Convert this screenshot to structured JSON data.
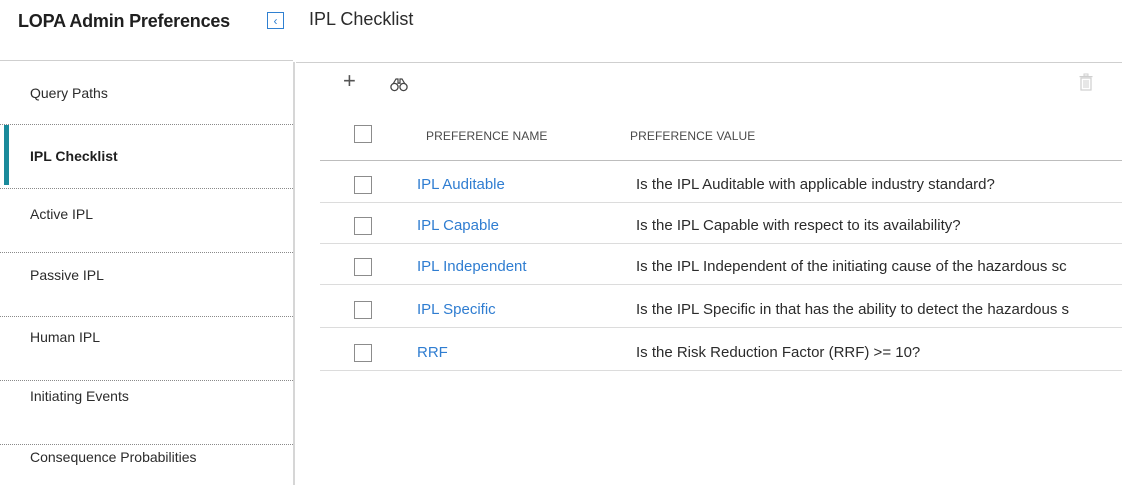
{
  "header": {
    "app_title": "LOPA Admin Preferences",
    "collapse_icon": "chevron-left-icon",
    "page_title": "IPL Checklist"
  },
  "sidebar": {
    "items": [
      {
        "label": "Query Paths",
        "active": false
      },
      {
        "label": "IPL Checklist",
        "active": true
      },
      {
        "label": "Active IPL",
        "active": false
      },
      {
        "label": "Passive IPL",
        "active": false
      },
      {
        "label": "Human IPL",
        "active": false
      },
      {
        "label": "Initiating Events",
        "active": false
      },
      {
        "label": "Consequence Probabilities",
        "active": false
      }
    ]
  },
  "toolbar": {
    "add_icon": "plus-icon",
    "search_icon": "binoculars-icon",
    "delete_icon": "trash-icon"
  },
  "table": {
    "columns": [
      "PREFERENCE NAME",
      "PREFERENCE VALUE"
    ],
    "rows": [
      {
        "name": "IPL Auditable",
        "value": "Is the IPL Auditable with applicable industry standard?"
      },
      {
        "name": "IPL Capable",
        "value": "Is the IPL Capable with respect to its availability?"
      },
      {
        "name": "IPL Independent",
        "value": "Is the IPL Independent of the initiating cause of the hazardous sc"
      },
      {
        "name": "IPL Specific",
        "value": "Is the IPL Specific in that has the ability to detect the hazardous s"
      },
      {
        "name": "RRF",
        "value": "Is the Risk Reduction Factor (RRF) >= 10?"
      }
    ]
  },
  "colors": {
    "accent": "#1a8a9b",
    "link": "#2f7dd1",
    "collapse_border": "#2f80d1"
  }
}
